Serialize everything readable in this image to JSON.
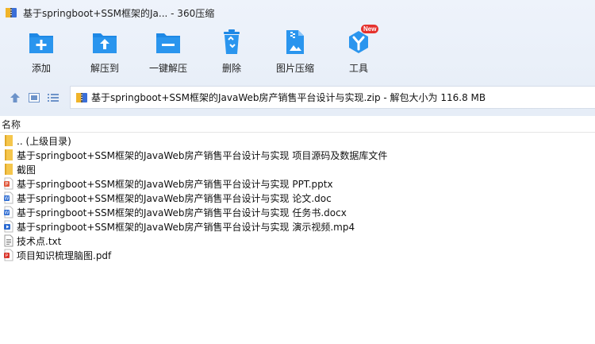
{
  "window": {
    "title": "基于springboot+SSM框架的Ja... - 360压缩"
  },
  "toolbar": {
    "items": [
      {
        "label": "添加",
        "icon": "add-icon"
      },
      {
        "label": "解压到",
        "icon": "extract-to-icon"
      },
      {
        "label": "一键解压",
        "icon": "one-click-extract-icon"
      },
      {
        "label": "删除",
        "icon": "trash-icon"
      },
      {
        "label": "图片压缩",
        "icon": "image-compress-icon"
      },
      {
        "label": "工具",
        "icon": "tools-icon",
        "badge": "New"
      }
    ]
  },
  "path": {
    "text": "基于springboot+SSM框架的JavaWeb房产销售平台设计与实现.zip - 解包大小为 116.8 MB"
  },
  "columns": {
    "name": "名称"
  },
  "files": [
    {
      "name": ".. (上级目录)",
      "type": "folder"
    },
    {
      "name": "基于springboot+SSM框架的JavaWeb房产销售平台设计与实现 项目源码及数据库文件",
      "type": "folder"
    },
    {
      "name": "截图",
      "type": "folder"
    },
    {
      "name": "基于springboot+SSM框架的JavaWeb房产销售平台设计与实现 PPT.pptx",
      "type": "pptx"
    },
    {
      "name": "基于springboot+SSM框架的JavaWeb房产销售平台设计与实现 论文.doc",
      "type": "doc"
    },
    {
      "name": "基于springboot+SSM框架的JavaWeb房产销售平台设计与实现 任务书.docx",
      "type": "doc"
    },
    {
      "name": "基于springboot+SSM框架的JavaWeb房产销售平台设计与实现 演示视频.mp4",
      "type": "video"
    },
    {
      "name": "技术点.txt",
      "type": "txt"
    },
    {
      "name": "项目知识梳理脑图.pdf",
      "type": "pdf"
    }
  ],
  "colors": {
    "accent": "#1e88e5",
    "chrome_bg": "#e6edf7",
    "folder": "#f5c64c",
    "pptx": "#e0573b",
    "doc": "#2b6ad1",
    "pdf": "#d9352b",
    "badge": "#e5322d"
  }
}
